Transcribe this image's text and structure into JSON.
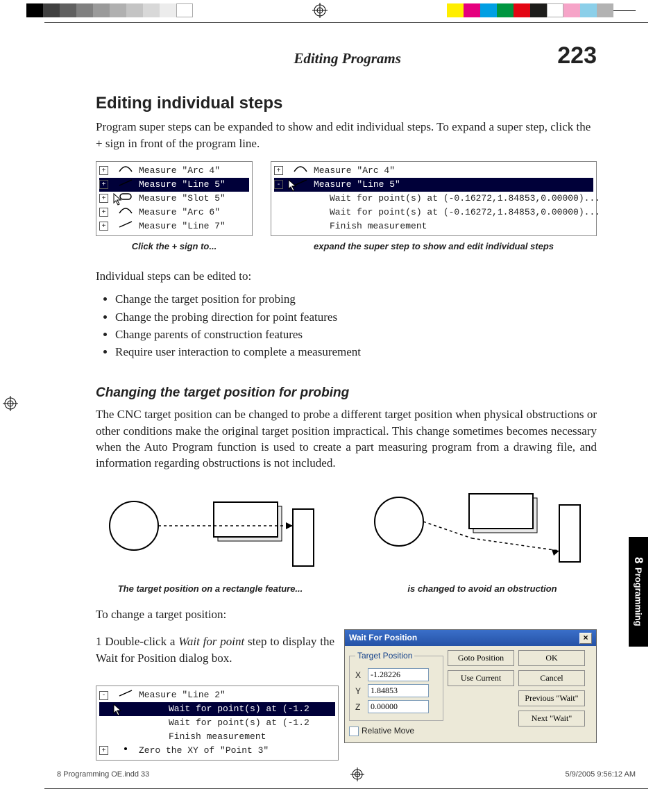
{
  "header": {
    "running_title": "Editing Programs",
    "page_number": "223"
  },
  "section": {
    "h1": "Editing individual steps",
    "intro": "Program super steps can be expanded to show and edit individual steps.  To expand a super step, click the + sign in front of the program line.",
    "after_edit": "Individual steps can be edited to:",
    "bullets": [
      "Change the target position for probing",
      "Change the probing direction for point features",
      "Change parents of construction features",
      "Require user interaction to complete a measurement"
    ],
    "h2": "Changing the target position for probing",
    "para2": "The CNC target position can be changed to probe a different target position when physical obstructions or other conditions make the original target position impractical.  This change sometimes becomes necessary when the Auto Program function is used to create a part measuring program from a drawing file, and information regarding obstructions is not included.",
    "lead2": "To change a target position:",
    "step1_a": "1    Double-click a ",
    "step1_i": "Wait for point",
    "step1_b": " step to display the Wait for Position dialog box."
  },
  "tree_left": {
    "rows": [
      {
        "pm": "+",
        "icon": "arc",
        "label": "Measure \"Arc 4\""
      },
      {
        "pm": "+",
        "icon": "line",
        "label": "Measure \"Line 5\"",
        "hl": true
      },
      {
        "pm": "+",
        "icon": "slot",
        "label": "Measure \"Slot 5\"",
        "cursor": true
      },
      {
        "pm": "+",
        "icon": "arc",
        "label": "Measure \"Arc 6\""
      },
      {
        "pm": "+",
        "icon": "line",
        "label": "Measure \"Line 7\""
      }
    ],
    "caption": "Click the + sign to..."
  },
  "tree_right": {
    "rows": [
      {
        "pm": "+",
        "icon": "arc",
        "label": "Measure \"Arc 4\""
      },
      {
        "pm": "-",
        "icon": "line",
        "label": "Measure \"Line 5\"",
        "hl": true,
        "cursor": true
      },
      {
        "sub": true,
        "label": "Wait for point(s) at (-0.16272,1.84853,0.00000)..."
      },
      {
        "sub": true,
        "label": "Wait for point(s) at (-0.16272,1.84853,0.00000)..."
      },
      {
        "sub": true,
        "label": "Finish measurement"
      }
    ],
    "caption": "expand the super step to show and edit individual steps"
  },
  "diag": {
    "left_caption": "The target position on a rectangle feature...",
    "right_caption": "is changed to avoid an obstruction"
  },
  "tree_bottom": {
    "rows": [
      {
        "pm": "-",
        "icon": "line",
        "label": "Measure \"Line 2\""
      },
      {
        "sub": true,
        "hl": true,
        "label": "Wait for point(s) at (-1.2",
        "cursor": true
      },
      {
        "sub": true,
        "label": "Wait for point(s) at (-1.2"
      },
      {
        "sub": true,
        "label": "Finish measurement"
      },
      {
        "pm": "+",
        "icon": "dot",
        "label": "Zero the XY of \"Point 3\""
      }
    ]
  },
  "dialog": {
    "title": "Wait For Position",
    "legend": "Target Position",
    "fields": [
      {
        "label": "X",
        "value": "-1.28226"
      },
      {
        "label": "Y",
        "value": "1.84853"
      },
      {
        "label": "Z",
        "value": "0.00000"
      }
    ],
    "relative": "Relative Move",
    "buttons_left": [
      "Goto Position",
      "Use Current"
    ],
    "buttons_right": [
      "OK",
      "Cancel",
      "Previous \"Wait\"",
      "Next \"Wait\""
    ]
  },
  "sidetab": {
    "num": "8",
    "label": "Programming"
  },
  "slug": {
    "file": "8 Programming OE.indd   33",
    "stamp": "5/9/2005   9:56:12 AM"
  }
}
